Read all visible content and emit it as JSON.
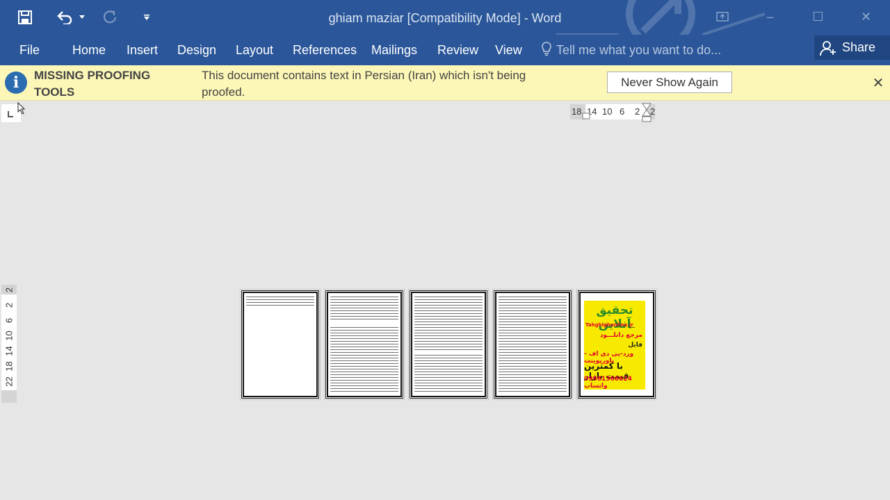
{
  "window": {
    "title": "ghiam maziar [Compatibility Mode] - Word",
    "controls": {
      "ribbon_display": "ribbon-display-icon",
      "minimize": "–",
      "maximize": "☐",
      "close": "✕"
    }
  },
  "quick_access": {
    "save": "save-icon",
    "undo": "undo-icon",
    "undo_dropdown": "caret-down-icon",
    "redo": "redo-icon",
    "customize": "customize-icon"
  },
  "ribbon": {
    "tabs": [
      {
        "label": "File"
      },
      {
        "label": "Home"
      },
      {
        "label": "Insert"
      },
      {
        "label": "Design"
      },
      {
        "label": "Layout"
      },
      {
        "label": "References"
      },
      {
        "label": "Mailings"
      },
      {
        "label": "Review"
      },
      {
        "label": "View"
      }
    ],
    "tell_me_placeholder": "Tell me what you want to do...",
    "share_label": "Share"
  },
  "message_bar": {
    "title": "MISSING PROOFING TOOLS",
    "text": "This document contains text in Persian (Iran) which isn't being proofed.",
    "button": "Never Show Again",
    "close": "✕"
  },
  "horizontal_ruler": {
    "numbers": [
      "18",
      "14",
      "10",
      "6",
      "2",
      "2"
    ]
  },
  "vertical_ruler": {
    "numbers": [
      "2",
      "2",
      "6",
      "10",
      "14",
      "18",
      "22"
    ]
  },
  "pages": {
    "count": 5,
    "ad": {
      "title": "تحقیق آنلاین",
      "site": "Tahghighonline.ir",
      "line1": "مرجع دانلـــود",
      "line2": "فایل",
      "line3": "ورد-پی دی اف - پاورپوینت",
      "line4": "با کمترین قیمت بازار",
      "phone": "09981366624 واتساپ"
    }
  }
}
